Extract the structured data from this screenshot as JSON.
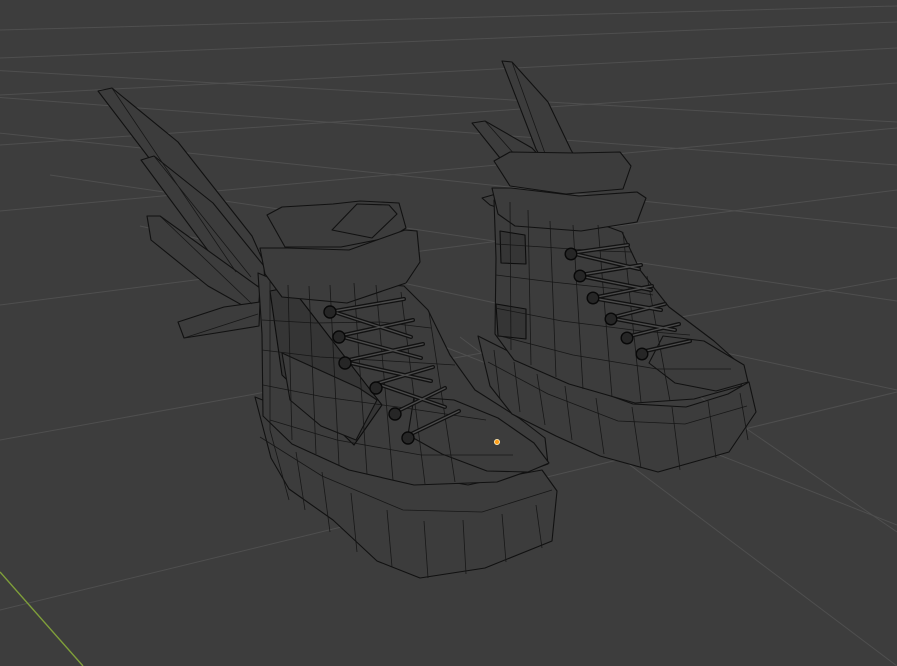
{
  "scene": {
    "background_color": "#3d3d3d",
    "grid_color": "#4f4f4f",
    "y_axis_color": "#7f9f3a",
    "wire_color": "#111111",
    "selected_vertex_color": "#ff9f1a"
  }
}
